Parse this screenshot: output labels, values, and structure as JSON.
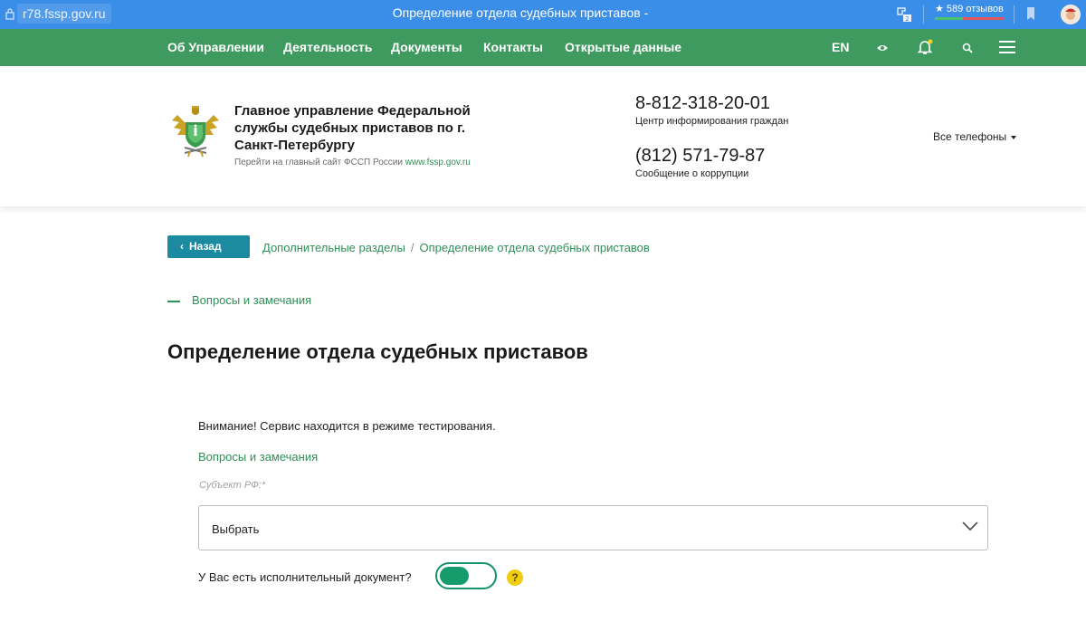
{
  "browser": {
    "url": "r78.fssp.gov.ru",
    "tab_title": "Определение отдела судебных приставов -",
    "ext_badge": "2",
    "rating_label": "★ 589 отзывов"
  },
  "nav": {
    "items": [
      "Об Управлении",
      "Деятельность",
      "Документы",
      "Контакты",
      "Открытые данные"
    ],
    "lang": "EN"
  },
  "header": {
    "org_name": "Главное управление Федеральной службы судебных приставов по г. Санкт-Петербургу",
    "org_sub_text": "Перейти на главный сайт ФССП России ",
    "org_sub_link": "www.fssp.gov.ru",
    "phone1": "8-812-318-20-01",
    "phone1_desc": "Центр информирования граждан",
    "phone2": "(812) 571-79-87",
    "phone2_desc": "Сообщение о коррупции",
    "all_phones": "Все телефоны"
  },
  "breadcrumbs": {
    "back_label": "Назад",
    "items": [
      "Дополнительные разделы",
      "Определение отдела судебных приставов"
    ]
  },
  "side_link": "Вопросы и замечания",
  "page_title": "Определение отдела судебных приставов",
  "form": {
    "warning": "Внимание! Сервис находится в режиме тестирования.",
    "feedback_link": "Вопросы и замечания",
    "subject_label": "Субъект РФ:*",
    "subject_value": "Выбрать",
    "doc_question": "У Вас есть исполнительный документ?",
    "help_symbol": "?"
  },
  "colors": {
    "browser_bar": "#3b8ee8",
    "nav_green": "#3e9a5f",
    "link_green": "#2f8f58",
    "back_button": "#1c8aa0",
    "toggle_green": "#159b6c",
    "help_yellow": "#f0cc12"
  }
}
